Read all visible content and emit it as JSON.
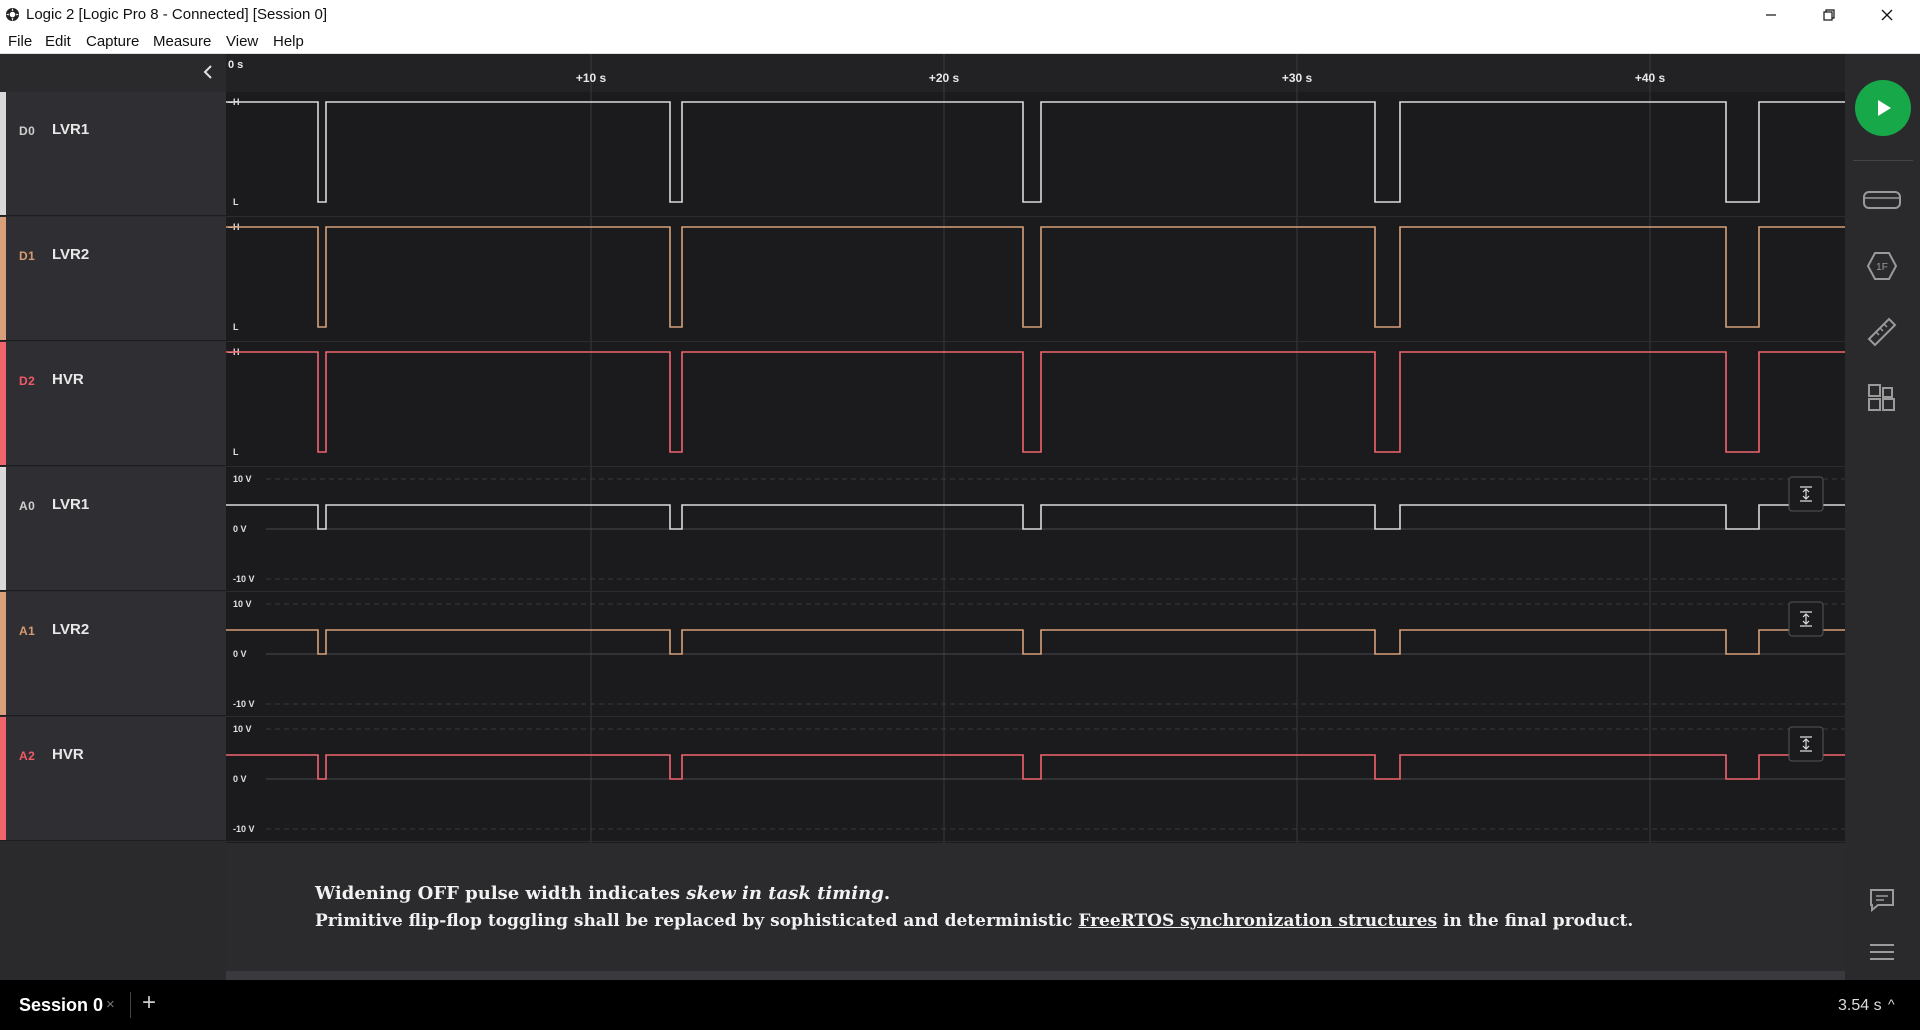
{
  "window": {
    "title": "Logic 2 [Logic Pro 8 - Connected] [Session 0]"
  },
  "menu": [
    "File",
    "Edit",
    "Capture",
    "Measure",
    "View",
    "Help"
  ],
  "timeline": {
    "origin_label": "0 s",
    "ticks": [
      "+10 s",
      "+20 s",
      "+30 s",
      "+40 s"
    ]
  },
  "channels": [
    {
      "id": "D0",
      "name": "LVR1",
      "kind": "digital",
      "color": "#d9d9d9",
      "id_color": "#cfcfcf"
    },
    {
      "id": "D1",
      "name": "LVR2",
      "kind": "digital",
      "color": "#d7a07a",
      "id_color": "#d89a72"
    },
    {
      "id": "D2",
      "name": "HVR",
      "kind": "digital",
      "color": "#f0646e",
      "id_color": "#f05a66"
    },
    {
      "id": "A0",
      "name": "LVR1",
      "kind": "analog",
      "color": "#d9d9d9",
      "id_color": "#cfcfcf"
    },
    {
      "id": "A1",
      "name": "LVR2",
      "kind": "analog",
      "color": "#d7a07a",
      "id_color": "#d89a72"
    },
    {
      "id": "A2",
      "name": "HVR",
      "kind": "analog",
      "color": "#f0646e",
      "id_color": "#f05a66"
    }
  ],
  "digital_labels": {
    "high": "H",
    "low": "L"
  },
  "analog_labels": {
    "top": "10 V",
    "mid": "0 V",
    "bottom": "-10 V"
  },
  "notes": {
    "line1_a": "Widening OFF pulse width indicates ",
    "line1_b": "skew in task timing",
    "line1_c": ".",
    "line2_a": "Primitive flip-flop toggling shall be replaced by sophisticated and deterministic ",
    "line2_b": "FreeRTOS synchronization structures",
    "line2_c": " in the final product."
  },
  "session": {
    "tab_label": "Session 0",
    "close_glyph": "×",
    "add_glyph": "+",
    "capture_length": "3.54 s",
    "expand_glyph": "^"
  }
}
